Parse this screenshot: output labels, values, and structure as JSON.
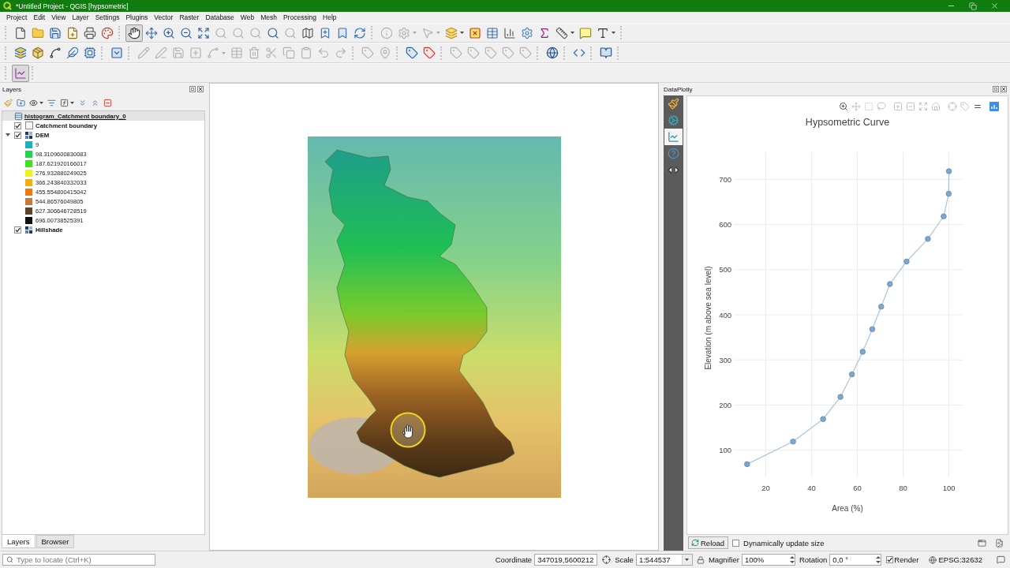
{
  "window": {
    "title": "*Untitled Project - QGIS [hypsometric]"
  },
  "menu": [
    "Project",
    "Edit",
    "View",
    "Layer",
    "Settings",
    "Plugins",
    "Vector",
    "Raster",
    "Database",
    "Web",
    "Mesh",
    "Processing",
    "Help"
  ],
  "toolbars": [
    [
      [
        {
          "kind": "new",
          "disabled": false,
          "dropdown": false,
          "selected": false
        },
        {
          "kind": "open",
          "disabled": false,
          "dropdown": false,
          "selected": false
        },
        {
          "kind": "save",
          "disabled": false,
          "dropdown": false,
          "selected": false
        },
        {
          "kind": "saveas",
          "disabled": false,
          "dropdown": false,
          "selected": false
        },
        {
          "kind": "layout",
          "disabled": false,
          "dropdown": false,
          "selected": false
        },
        {
          "kind": "style",
          "disabled": false,
          "dropdown": false,
          "selected": false
        }
      ],
      [
        {
          "kind": "pan",
          "disabled": false,
          "dropdown": false,
          "selected": true
        },
        {
          "kind": "pantoselection",
          "disabled": false,
          "dropdown": false,
          "selected": false
        },
        {
          "kind": "zoomin",
          "disabled": false,
          "dropdown": false,
          "selected": false
        },
        {
          "kind": "zoomout",
          "disabled": false,
          "dropdown": false,
          "selected": false
        },
        {
          "kind": "zoomfull",
          "disabled": false,
          "dropdown": false,
          "selected": false
        },
        {
          "kind": "zoomselection",
          "disabled": true,
          "dropdown": false,
          "selected": false
        },
        {
          "kind": "zoomlayer",
          "disabled": true,
          "dropdown": false,
          "selected": false
        },
        {
          "kind": "zoomnative",
          "disabled": true,
          "dropdown": false,
          "selected": false
        },
        {
          "kind": "zoomlast",
          "disabled": false,
          "dropdown": false,
          "selected": false
        },
        {
          "kind": "zoomnext",
          "disabled": true,
          "dropdown": false,
          "selected": false
        },
        {
          "kind": "mapview",
          "disabled": false,
          "dropdown": false,
          "selected": false
        },
        {
          "kind": "newbookmark",
          "disabled": false,
          "dropdown": false,
          "selected": false
        },
        {
          "kind": "bookmarks",
          "disabled": false,
          "dropdown": false,
          "selected": false
        },
        {
          "kind": "refresh",
          "disabled": false,
          "dropdown": false,
          "selected": false
        }
      ],
      [
        {
          "kind": "identify",
          "disabled": true,
          "dropdown": false,
          "selected": false
        },
        {
          "kind": "actions",
          "disabled": true,
          "dropdown": true,
          "selected": false
        },
        {
          "kind": "select",
          "disabled": true,
          "dropdown": true,
          "selected": false
        },
        {
          "kind": "selectvalue",
          "disabled": false,
          "dropdown": true,
          "selected": false
        },
        {
          "kind": "deselect",
          "disabled": false,
          "dropdown": false,
          "selected": false
        },
        {
          "kind": "attrtable",
          "disabled": false,
          "dropdown": false,
          "selected": false
        },
        {
          "kind": "stats",
          "disabled": false,
          "dropdown": false,
          "selected": false
        },
        {
          "kind": "toolbox",
          "disabled": false,
          "dropdown": false,
          "selected": false
        },
        {
          "kind": "sigma",
          "disabled": false,
          "dropdown": false,
          "selected": false
        },
        {
          "kind": "measure",
          "disabled": false,
          "dropdown": true,
          "selected": false
        },
        {
          "kind": "annotation",
          "disabled": false,
          "dropdown": false,
          "selected": false
        },
        {
          "kind": "textannotation",
          "disabled": false,
          "dropdown": true,
          "selected": false
        }
      ]
    ],
    [
      [
        {
          "kind": "datasource",
          "disabled": false,
          "dropdown": false
        },
        {
          "kind": "geopackage",
          "disabled": false,
          "dropdown": false
        },
        {
          "kind": "shapefile",
          "disabled": false,
          "dropdown": false
        },
        {
          "kind": "scratch",
          "disabled": false,
          "dropdown": false
        },
        {
          "kind": "virtual",
          "disabled": false,
          "dropdown": false
        }
      ],
      [
        {
          "kind": "vlayer",
          "disabled": false,
          "dropdown": false
        }
      ],
      [
        {
          "kind": "currentedits",
          "disabled": true,
          "dropdown": false
        },
        {
          "kind": "toggleedit",
          "disabled": true,
          "dropdown": false
        },
        {
          "kind": "saveedits",
          "disabled": true,
          "dropdown": false
        },
        {
          "kind": "addfeature",
          "disabled": true,
          "dropdown": false
        },
        {
          "kind": "vertex",
          "disabled": true,
          "dropdown": true
        },
        {
          "kind": "modattr",
          "disabled": true,
          "dropdown": false
        },
        {
          "kind": "delete",
          "disabled": true,
          "dropdown": false
        },
        {
          "kind": "cut",
          "disabled": true,
          "dropdown": false
        },
        {
          "kind": "copy",
          "disabled": true,
          "dropdown": false
        },
        {
          "kind": "paste",
          "disabled": true,
          "dropdown": false
        },
        {
          "kind": "undo",
          "disabled": true,
          "dropdown": false
        },
        {
          "kind": "redo",
          "disabled": true,
          "dropdown": false
        }
      ],
      [
        {
          "kind": "labeltool",
          "disabled": true,
          "dropdown": false
        },
        {
          "kind": "pinlabel",
          "disabled": true,
          "dropdown": false
        }
      ],
      [
        {
          "kind": "layerlabeling",
          "disabled": false,
          "dropdown": false
        },
        {
          "kind": "rulelabeling",
          "disabled": false,
          "dropdown": false
        }
      ],
      [
        {
          "kind": "highlightpins",
          "disabled": true,
          "dropdown": false
        },
        {
          "kind": "movelabel",
          "disabled": true,
          "dropdown": false
        },
        {
          "kind": "rotatelabel",
          "disabled": true,
          "dropdown": false
        },
        {
          "kind": "changelabel",
          "disabled": true,
          "dropdown": false
        },
        {
          "kind": "showhide",
          "disabled": true,
          "dropdown": false
        }
      ],
      [
        {
          "kind": "geocoder",
          "disabled": false,
          "dropdown": false
        }
      ],
      [
        {
          "kind": "python",
          "disabled": false,
          "dropdown": false
        }
      ],
      [
        {
          "kind": "help",
          "disabled": false,
          "dropdown": false
        }
      ]
    ],
    [
      [
        {
          "kind": "dataplotly",
          "disabled": false,
          "dropdown": false,
          "selected": true
        }
      ]
    ]
  ],
  "layers_panel": {
    "title": "Layers",
    "tools": [
      {
        "kind": "brush",
        "dropdown": false
      },
      {
        "kind": "addgroup",
        "dropdown": false
      },
      {
        "kind": "visibility",
        "dropdown": true
      },
      {
        "kind": "filter",
        "dropdown": false
      },
      {
        "kind": "expression",
        "dropdown": true
      },
      {
        "kind": "expandall",
        "dropdown": false
      },
      {
        "kind": "collapseall",
        "dropdown": false
      },
      {
        "kind": "remove",
        "dropdown": false
      }
    ],
    "tree": [
      {
        "kind": "table",
        "name": "histogram_Catchment boundary_0",
        "selected": true,
        "underlined": true
      },
      {
        "kind": "polygon",
        "name": "Catchment boundary",
        "checked": true,
        "selected": false,
        "underlined": false
      },
      {
        "kind": "raster",
        "name": "DEM",
        "checked": true,
        "expanded": true,
        "selected": false,
        "underlined": false,
        "children": [
          {
            "label": "9",
            "color": "#17b3c2"
          },
          {
            "label": "98.3109600830083",
            "color": "#1fd651"
          },
          {
            "label": "187.621920166017",
            "color": "#3ae61b"
          },
          {
            "label": "276.932880249025",
            "color": "#f0f21b"
          },
          {
            "label": "366.243840332033",
            "color": "#f7ad0c"
          },
          {
            "label": "455.554800415042",
            "color": "#ec7a14"
          },
          {
            "label": "544.86576049805",
            "color": "#c47a3c"
          },
          {
            "label": "627.306646728519",
            "color": "#5e4326"
          },
          {
            "label": "696.00738525391",
            "color": "#111111"
          }
        ]
      },
      {
        "kind": "raster",
        "name": "Hillshade",
        "checked": true,
        "selected": false,
        "underlined": false
      }
    ],
    "tabs": [
      {
        "label": "Layers",
        "selected": true
      },
      {
        "label": "Browser",
        "selected": false
      }
    ]
  },
  "dataplotly": {
    "title": "DataPlotly",
    "sidebar": [
      {
        "kind": "settings",
        "selected": false
      },
      {
        "kind": "customize",
        "selected": false
      },
      {
        "kind": "plot",
        "selected": true
      },
      {
        "kind": "help",
        "selected": false
      },
      {
        "kind": "code",
        "selected": false
      }
    ],
    "modebar": [
      [
        {
          "kind": "zoom",
          "selected": true
        },
        {
          "kind": "pan",
          "selected": false
        },
        {
          "kind": "boxselect",
          "selected": false
        },
        {
          "kind": "lasso",
          "selected": false
        }
      ],
      [
        {
          "kind": "zoomin",
          "selected": false
        },
        {
          "kind": "zoomout",
          "selected": false
        },
        {
          "kind": "autoscale",
          "selected": false
        },
        {
          "kind": "reset",
          "selected": false
        }
      ],
      [
        {
          "kind": "spikelines",
          "selected": false
        },
        {
          "kind": "hoverclosest",
          "selected": false
        },
        {
          "kind": "hovercompare",
          "selected": true
        }
      ]
    ],
    "chart_data": {
      "type": "line",
      "title": "Hypsometric Curve",
      "xlabel": "Area (%)",
      "ylabel": "Elevation (m above sea level)",
      "x": [
        11.8,
        31.9,
        45.0,
        52.6,
        57.6,
        62.3,
        66.5,
        70.4,
        74.2,
        81.5,
        90.8,
        97.7,
        99.9,
        100
      ],
      "series": [
        {
          "color": "#7fa6cb",
          "marker": "circle",
          "values": [
            69,
            119,
            169,
            218,
            268,
            318,
            368,
            418,
            468,
            518,
            568,
            618,
            668,
            718
          ]
        }
      ],
      "xlim": [
        6,
        106
      ],
      "ylim": [
        40,
        760
      ],
      "xticks": [
        20,
        40,
        60,
        80,
        100
      ],
      "yticks": [
        100,
        200,
        300,
        400,
        500,
        600,
        700
      ],
      "grid": true
    },
    "reload_button": "Reload",
    "dynamic_size": {
      "label": "Dynamically update size",
      "checked": false
    }
  },
  "status_bar": {
    "locator": {
      "placeholder": "Type to locate (Ctrl+K)"
    },
    "coordinate": {
      "label": "Coordinate",
      "value": "347019,5600212"
    },
    "scale": {
      "label": "Scale",
      "value": "1:544537"
    },
    "magnifier": {
      "label": "Magnifier",
      "value": "100%"
    },
    "rotation": {
      "label": "Rotation",
      "value": "0,0 °"
    },
    "render": {
      "label": "Render",
      "checked": true
    },
    "crs": "EPSG:32632"
  }
}
